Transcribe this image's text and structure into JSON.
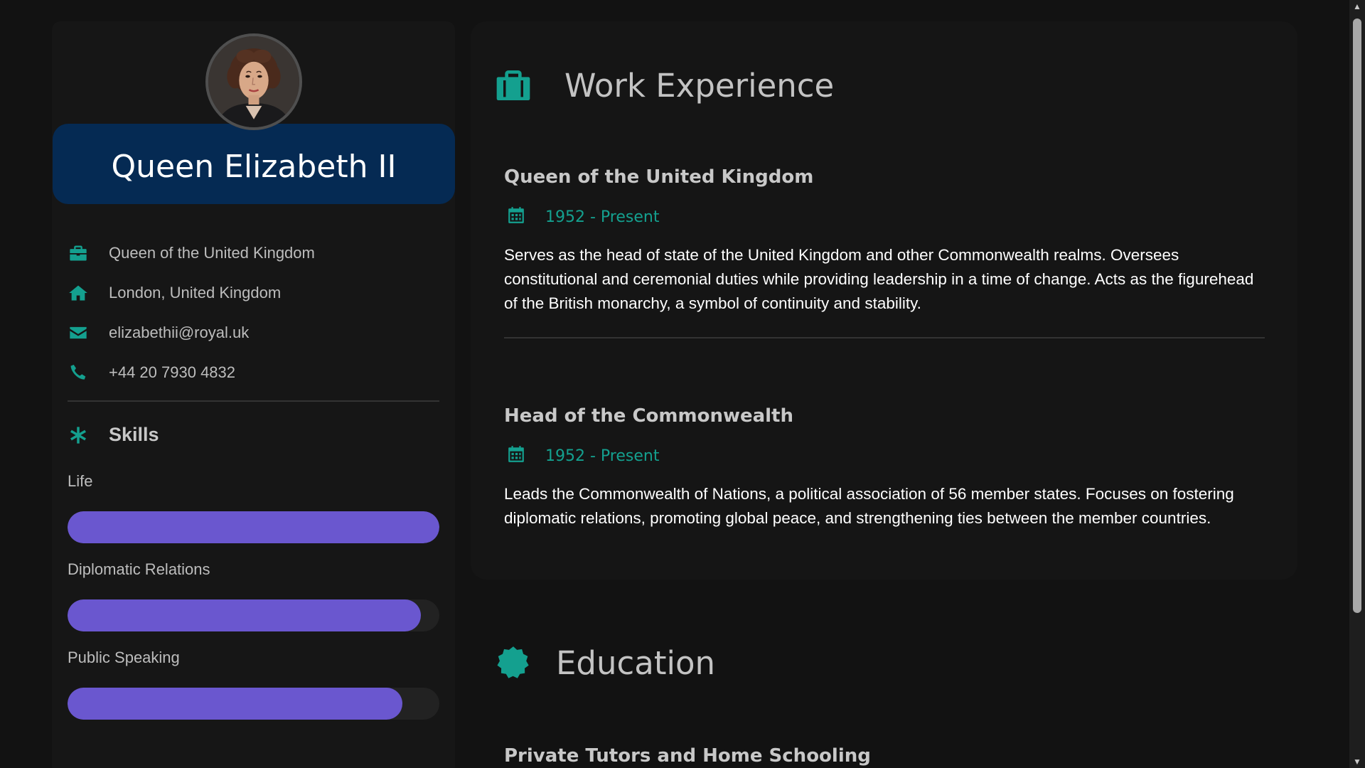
{
  "profile": {
    "name": "Queen Elizabeth II",
    "avatar_alt": "portrait"
  },
  "contact": [
    {
      "icon": "briefcase-icon",
      "text": "Queen of the United Kingdom"
    },
    {
      "icon": "home-icon",
      "text": "London, United Kingdom"
    },
    {
      "icon": "envelope-icon",
      "text": "elizabethii@royal.uk"
    },
    {
      "icon": "phone-icon",
      "text": "+44 20 7930 4832"
    }
  ],
  "skills": {
    "heading": "Skills",
    "icon": "asterisk-icon",
    "items": [
      {
        "label": "Life",
        "level": 100
      },
      {
        "label": "Diplomatic Relations",
        "level": 95
      },
      {
        "label": "Public Speaking",
        "level": 90
      }
    ]
  },
  "work": {
    "heading": "Work Experience",
    "icon": "briefcase-icon",
    "jobs": [
      {
        "title": "Queen of the United Kingdom",
        "date": "1952 - Present",
        "description": "Serves as the head of state of the United Kingdom and other Commonwealth realms. Oversees constitutional and ceremonial duties while providing leadership in a time of change. Acts as the figurehead of the British monarchy, a symbol of continuity and stability."
      },
      {
        "title": "Head of the Commonwealth",
        "date": "1952 - Present",
        "description": "Leads the Commonwealth of Nations, a political association of 56 member states. Focuses on fostering diplomatic relations, promoting global peace, and strengthening ties between the member countries."
      }
    ]
  },
  "education": {
    "heading": "Education",
    "icon": "certificate-icon",
    "items": [
      {
        "title": "Private Tutors and Home Schooling"
      }
    ]
  },
  "colors": {
    "accent": "#14a08f",
    "banner": "#052a53",
    "skill_bar": "#6a57cf",
    "background": "#121212"
  }
}
